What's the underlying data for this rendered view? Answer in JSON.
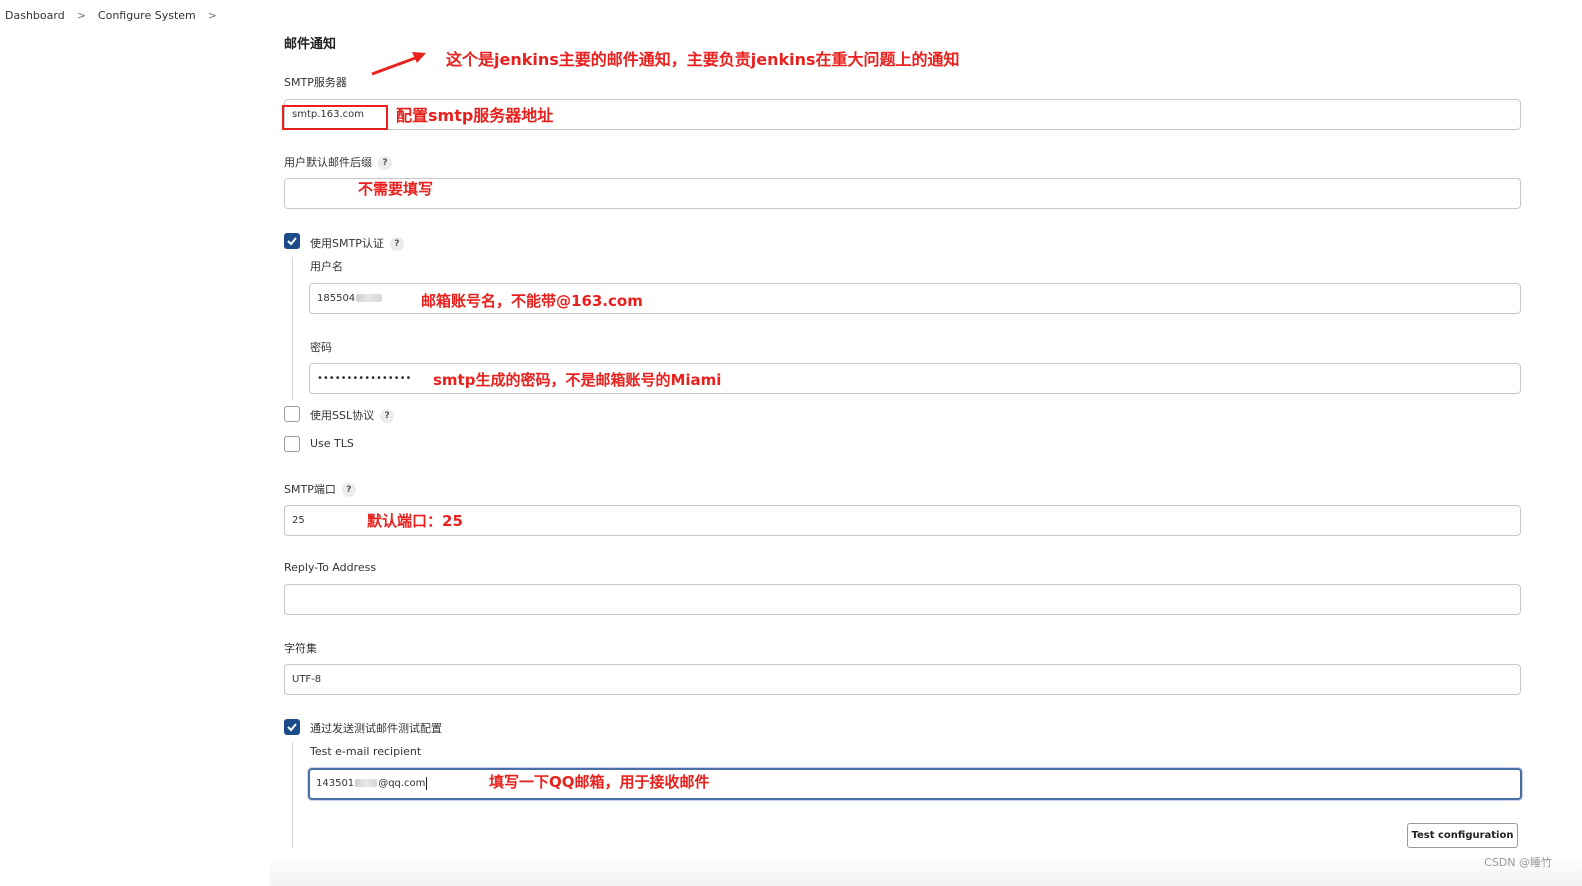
{
  "breadcrumb": {
    "items": [
      "Dashboard",
      "Configure System"
    ],
    "separator": ">"
  },
  "section": {
    "title": "邮件通知"
  },
  "smtp_server": {
    "label": "SMTP服务器",
    "value": "smtp.163.com"
  },
  "default_suffix": {
    "label": "用户默认邮件后缀",
    "help": "?",
    "value": ""
  },
  "use_smtp_auth": {
    "label": "使用SMTP认证",
    "help": "?",
    "checked": true
  },
  "username": {
    "label": "用户名",
    "value_visible": "185504"
  },
  "password": {
    "label": "密码",
    "value": "••••••••••••••••"
  },
  "use_ssl": {
    "label": "使用SSL协议",
    "help": "?",
    "checked": false
  },
  "use_tls": {
    "label": "Use TLS",
    "checked": false
  },
  "smtp_port": {
    "label": "SMTP端口",
    "help": "?",
    "value": "25"
  },
  "reply_to": {
    "label": "Reply-To Address",
    "value": ""
  },
  "charset": {
    "label": "字符集",
    "value": "UTF-8"
  },
  "test_config": {
    "label": "通过发送测试邮件测试配置",
    "checked": true
  },
  "test_recipient": {
    "label": "Test e-mail recipient",
    "value_prefix": "143501",
    "value_suffix": "@qq.com"
  },
  "test_button": {
    "label": "Test configuration"
  },
  "annotations": {
    "title": "这个是jenkins主要的邮件通知，主要负责jenkins在重大问题上的通知",
    "smtp_server": "配置smtp服务器地址",
    "default_suffix": "不需要填写",
    "username": "邮箱账号名，不能带@163.com",
    "password": "smtp生成的密码，不是邮箱账号的Miami",
    "smtp_port": "默认端口：25",
    "test_recipient": "填写一下QQ邮箱，用于接收邮件"
  },
  "watermark": "CSDN @睡竹",
  "colors": {
    "annotation": "#e8211e",
    "checkbox_checked": "#1c4b8a",
    "focus_border": "#4a6fa5"
  },
  "icons": {
    "breadcrumb_separator": "chevron-right-icon",
    "help": "question-mark-icon",
    "check": "checkmark-icon",
    "annotation_arrow": "arrow-icon"
  }
}
